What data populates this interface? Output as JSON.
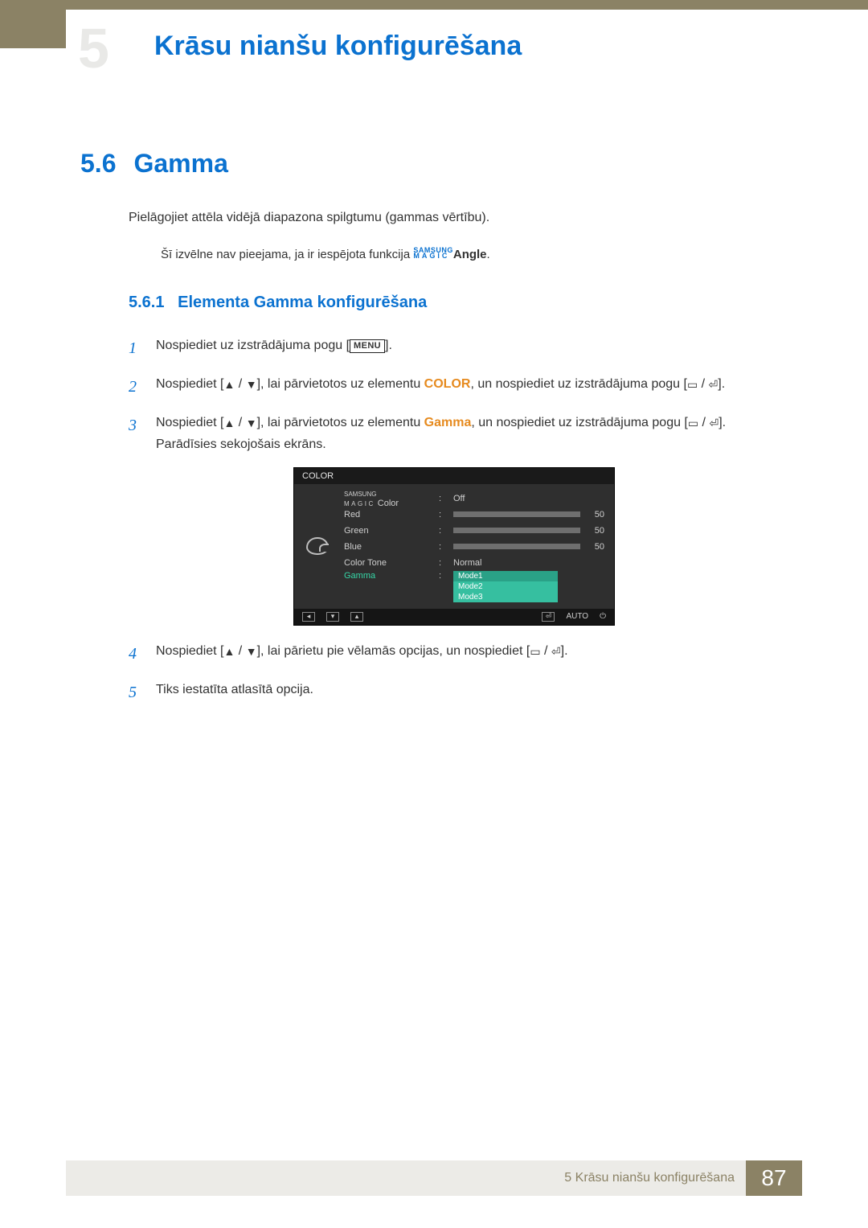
{
  "chapter": {
    "number_bg": "5",
    "title": "Krāsu nianšu konfigurēšana"
  },
  "section": {
    "number": "5.6",
    "title": "Gamma",
    "intro": "Pielāgojiet attēla vidējā diapazona spilgtumu (gammas vērtību).",
    "note_pre": "Šī izvēlne nav pieejama, ja ir iespējota funkcija ",
    "note_brand_top": "SAMSUNG",
    "note_brand_bottom": "MAGIC",
    "note_post": "Angle",
    "note_end": "."
  },
  "subsection": {
    "number": "5.6.1",
    "title": "Elementa Gamma konfigurēšana"
  },
  "steps": {
    "s1_num": "1",
    "s1_a": "Nospiediet uz izstrādājuma pogu [",
    "s1_menu": "MENU",
    "s1_b": "].",
    "s2_num": "2",
    "s2_a": "Nospiediet [",
    "s2_b": "], lai pārvietotos uz elementu ",
    "s2_kw": "COLOR",
    "s2_c": ", un nospiediet uz izstrādājuma pogu [",
    "s2_d": "].",
    "s3_num": "3",
    "s3_a": "Nospiediet [",
    "s3_b": "], lai pārvietotos uz elementu ",
    "s3_kw": "Gamma",
    "s3_c": ", un nospiediet uz izstrādājuma pogu [",
    "s3_d": "]. Parādīsies sekojošais ekrāns.",
    "s4_num": "4",
    "s4_a": "Nospiediet [",
    "s4_b": "], lai pārietu pie vēlamās opcijas, un nospiediet [",
    "s4_c": "].",
    "s5_num": "5",
    "s5_a": "Tiks iestatīta atlasītā opcija."
  },
  "osd": {
    "title": "COLOR",
    "magic_top": "SAMSUNG",
    "magic_bottom": "MAGIC",
    "magic_color_label": "Color",
    "magic_color_value": "Off",
    "red_label": "Red",
    "green_label": "Green",
    "blue_label": "Blue",
    "red_value": "50",
    "green_value": "50",
    "blue_value": "50",
    "tone_label": "Color Tone",
    "tone_value": "Normal",
    "gamma_label": "Gamma",
    "mode1": "Mode1",
    "mode2": "Mode2",
    "mode3": "Mode3",
    "auto": "AUTO"
  },
  "footer": {
    "label": "5 Krāsu nianšu konfigurēšana",
    "page": "87"
  }
}
